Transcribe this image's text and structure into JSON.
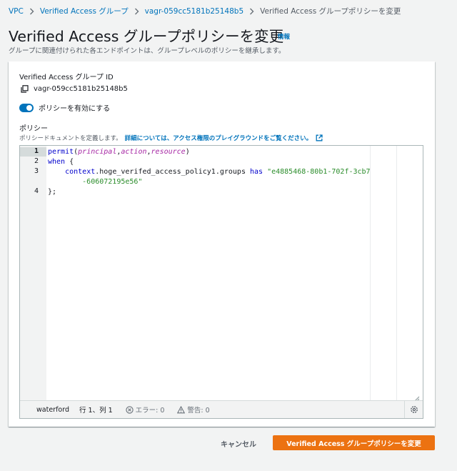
{
  "breadcrumb": {
    "items": [
      "VPC",
      "Verified Access グループ",
      "vagr-059cc5181b25148b5"
    ],
    "current": "Verified Access グループポリシーを変更"
  },
  "header": {
    "title": "Verified Access グループポリシーを変更",
    "info": "情報",
    "description": "グループに関連付けられた各エンドポイントは、グループレベルのポリシーを継承します。"
  },
  "form": {
    "group_id_label": "Verified Access グループ ID",
    "group_id_value": "vagr-059cc5181b25148b5",
    "toggle_label": "ポリシーを有効にする",
    "toggle_on": true,
    "policy_label": "ポリシー",
    "policy_desc": "ポリシードキュメントを定義します。",
    "policy_link": "詳細については、アクセス権限のプレイグラウンドをご覧ください。"
  },
  "editor": {
    "line_numbers": [
      "1",
      "2",
      "3",
      "4"
    ],
    "code": {
      "l1_kw": "permit",
      "l1_open": "(",
      "l1_p1": "principal",
      "l1_c1": ",",
      "l1_p2": "action",
      "l1_c2": ",",
      "l1_p3": "resource",
      "l1_close": ")",
      "l2_kw": "when",
      "l2_rest": " {",
      "l3_indent": "    ",
      "l3_ctx": "context",
      "l3_attr": ".hoge_verifed_access_policy1.groups ",
      "l3_has": "has",
      "l3_str1": " \"e4885468-80b1-702f-3cb7",
      "l3_str2": "        -606072195e56\"",
      "l4": "};"
    },
    "status": {
      "theme": "waterford",
      "position": "行 1、列 1",
      "errors": "エラー: 0",
      "warnings": "警告: 0"
    }
  },
  "actions": {
    "cancel": "キャンセル",
    "submit": "Verified Access グループポリシーを変更"
  },
  "colors": {
    "link": "#0073bb",
    "primary": "#ec7211",
    "background": "#f2f3f3"
  }
}
